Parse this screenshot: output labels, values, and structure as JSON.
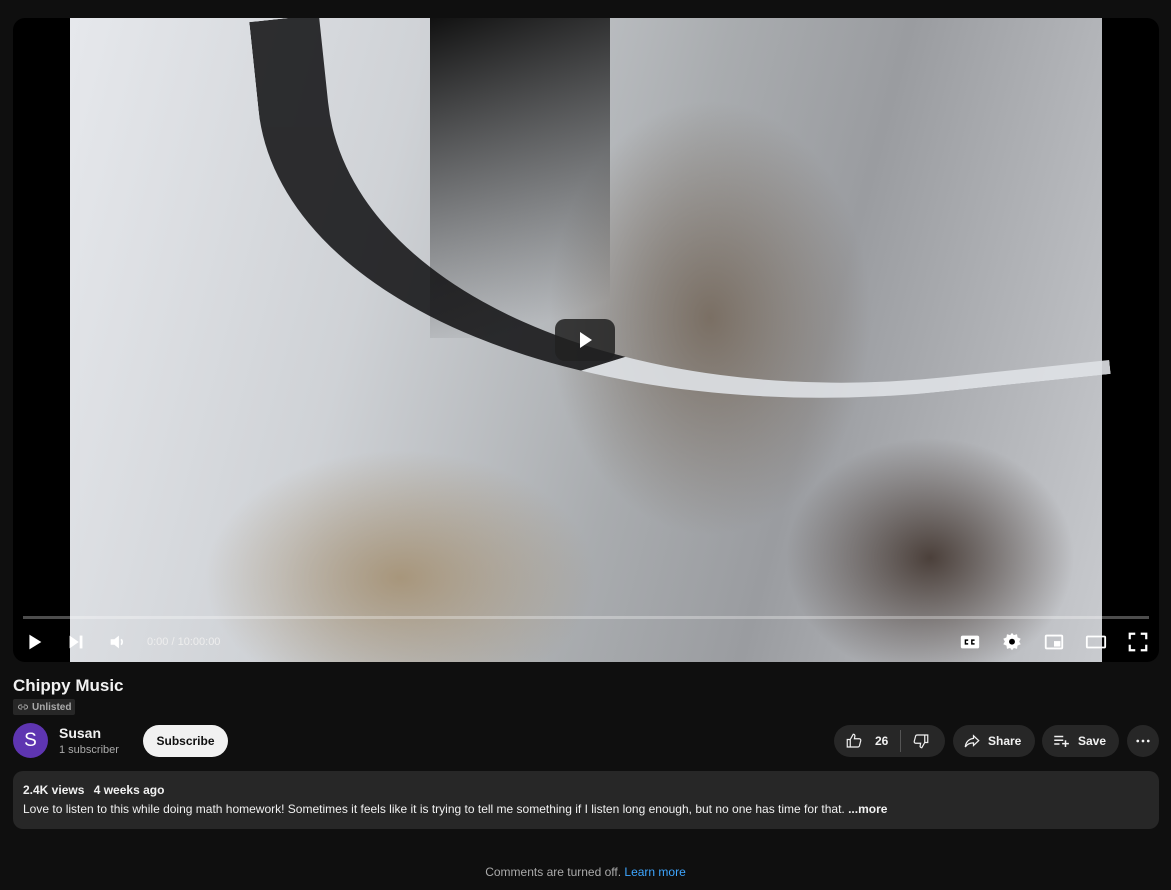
{
  "player": {
    "current_time": "0:00",
    "separator": "/",
    "duration": "10:00:00",
    "progress": 0
  },
  "video": {
    "title": "Chippy Music",
    "visibility": "Unlisted"
  },
  "channel": {
    "avatar_letter": "S",
    "name": "Susan",
    "subscribers": "1 subscriber",
    "subscribe_label": "Subscribe"
  },
  "actions": {
    "like_count": "26",
    "share_label": "Share",
    "save_label": "Save"
  },
  "description": {
    "views": "2.4K views",
    "age": "4 weeks ago",
    "text": "Love to listen to this while doing math homework! Sometimes it feels like it is trying to tell me something if I listen long enough, but no one has time for that.",
    "more_label": "...more"
  },
  "comments": {
    "notice": "Comments are turned off.",
    "learn_more": "Learn more"
  },
  "colors": {
    "background": "#0f0f0f",
    "surface": "#272727",
    "accent_red": "#ff0000",
    "link": "#3ea6ff",
    "avatar": "#5e35b1"
  },
  "icons": [
    "play-icon",
    "next-icon",
    "volume-icon",
    "cc-icon",
    "settings-icon",
    "miniplayer-icon",
    "theater-icon",
    "fullscreen-icon",
    "link-icon",
    "thumbs-up-icon",
    "thumbs-down-icon",
    "share-icon",
    "playlist-add-icon",
    "more-icon"
  ]
}
